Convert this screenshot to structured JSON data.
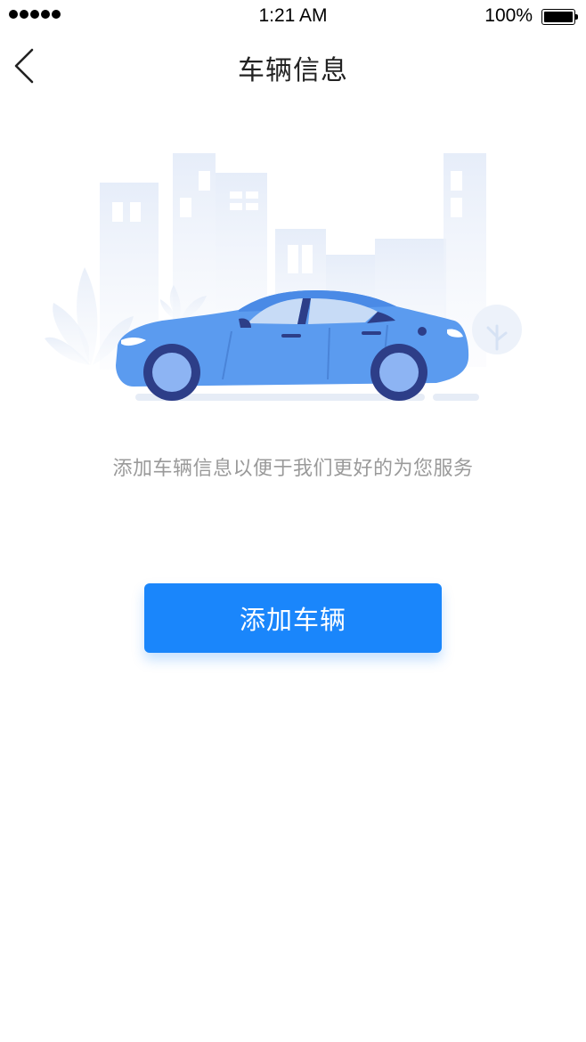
{
  "status_bar": {
    "time": "1:21 AM",
    "battery_percent": "100%",
    "signal_icon": "signal-dots-icon",
    "battery_icon": "battery-full-icon"
  },
  "nav": {
    "title": "车辆信息",
    "back_icon": "chevron-left-icon"
  },
  "illustration": {
    "icon": "car-city-illustration"
  },
  "empty_state": {
    "description": "添加车辆信息以便于我们更好的为您服务"
  },
  "actions": {
    "add_vehicle_label": "添加车辆"
  },
  "colors": {
    "primary": "#1a86fb",
    "car_body": "#5b9bef",
    "building": "#e8eef9",
    "text_muted": "#9a9a9a"
  }
}
